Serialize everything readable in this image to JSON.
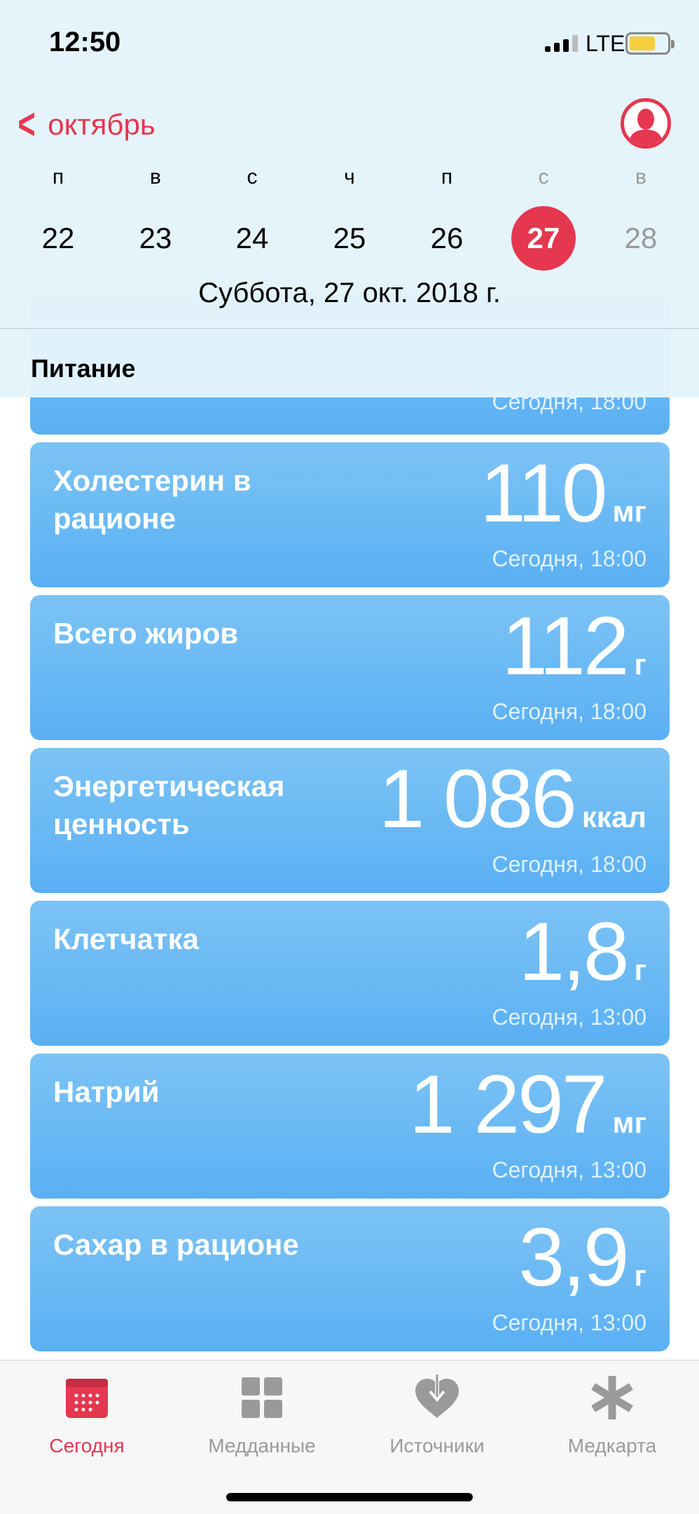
{
  "status_bar": {
    "time": "12:50",
    "network": "LTE"
  },
  "header": {
    "back_label": "октябрь",
    "weekdays": [
      "п",
      "в",
      "с",
      "ч",
      "п",
      "с",
      "в"
    ],
    "dates": [
      "22",
      "23",
      "24",
      "25",
      "26",
      "27",
      "28"
    ],
    "selected_date": "27",
    "full_date": "Суббота, 27 окт. 2018 г.",
    "section_title": "Питание"
  },
  "cards": [
    {
      "title": "",
      "value": "",
      "unit": "",
      "time": "Сегодня, 18:00"
    },
    {
      "title": "Холестерин в рационе",
      "value": "110",
      "unit": "мг",
      "time": "Сегодня, 18:00"
    },
    {
      "title": "Всего жиров",
      "value": "112",
      "unit": "г",
      "time": "Сегодня, 18:00"
    },
    {
      "title": "Энергетическая ценность",
      "value": "1 086",
      "unit": "ккал",
      "time": "Сегодня, 18:00"
    },
    {
      "title": "Клетчатка",
      "value": "1,8",
      "unit": "г",
      "time": "Сегодня, 13:00"
    },
    {
      "title": "Натрий",
      "value": "1 297",
      "unit": "мг",
      "time": "Сегодня, 13:00"
    },
    {
      "title": "Сахар в рационе",
      "value": "3,9",
      "unit": "г",
      "time": "Сегодня, 13:00"
    }
  ],
  "tabs": [
    {
      "label": "Сегодня",
      "icon": "calendar-icon",
      "active": true
    },
    {
      "label": "Медданные",
      "icon": "grid-icon",
      "active": false
    },
    {
      "label": "Источники",
      "icon": "heart-download-icon",
      "active": false
    },
    {
      "label": "Медкарта",
      "icon": "asterisk-icon",
      "active": false
    }
  ],
  "colors": {
    "accent": "#e5374f",
    "card": "#6ab9f5",
    "header_bg": "#e4f4fb"
  }
}
